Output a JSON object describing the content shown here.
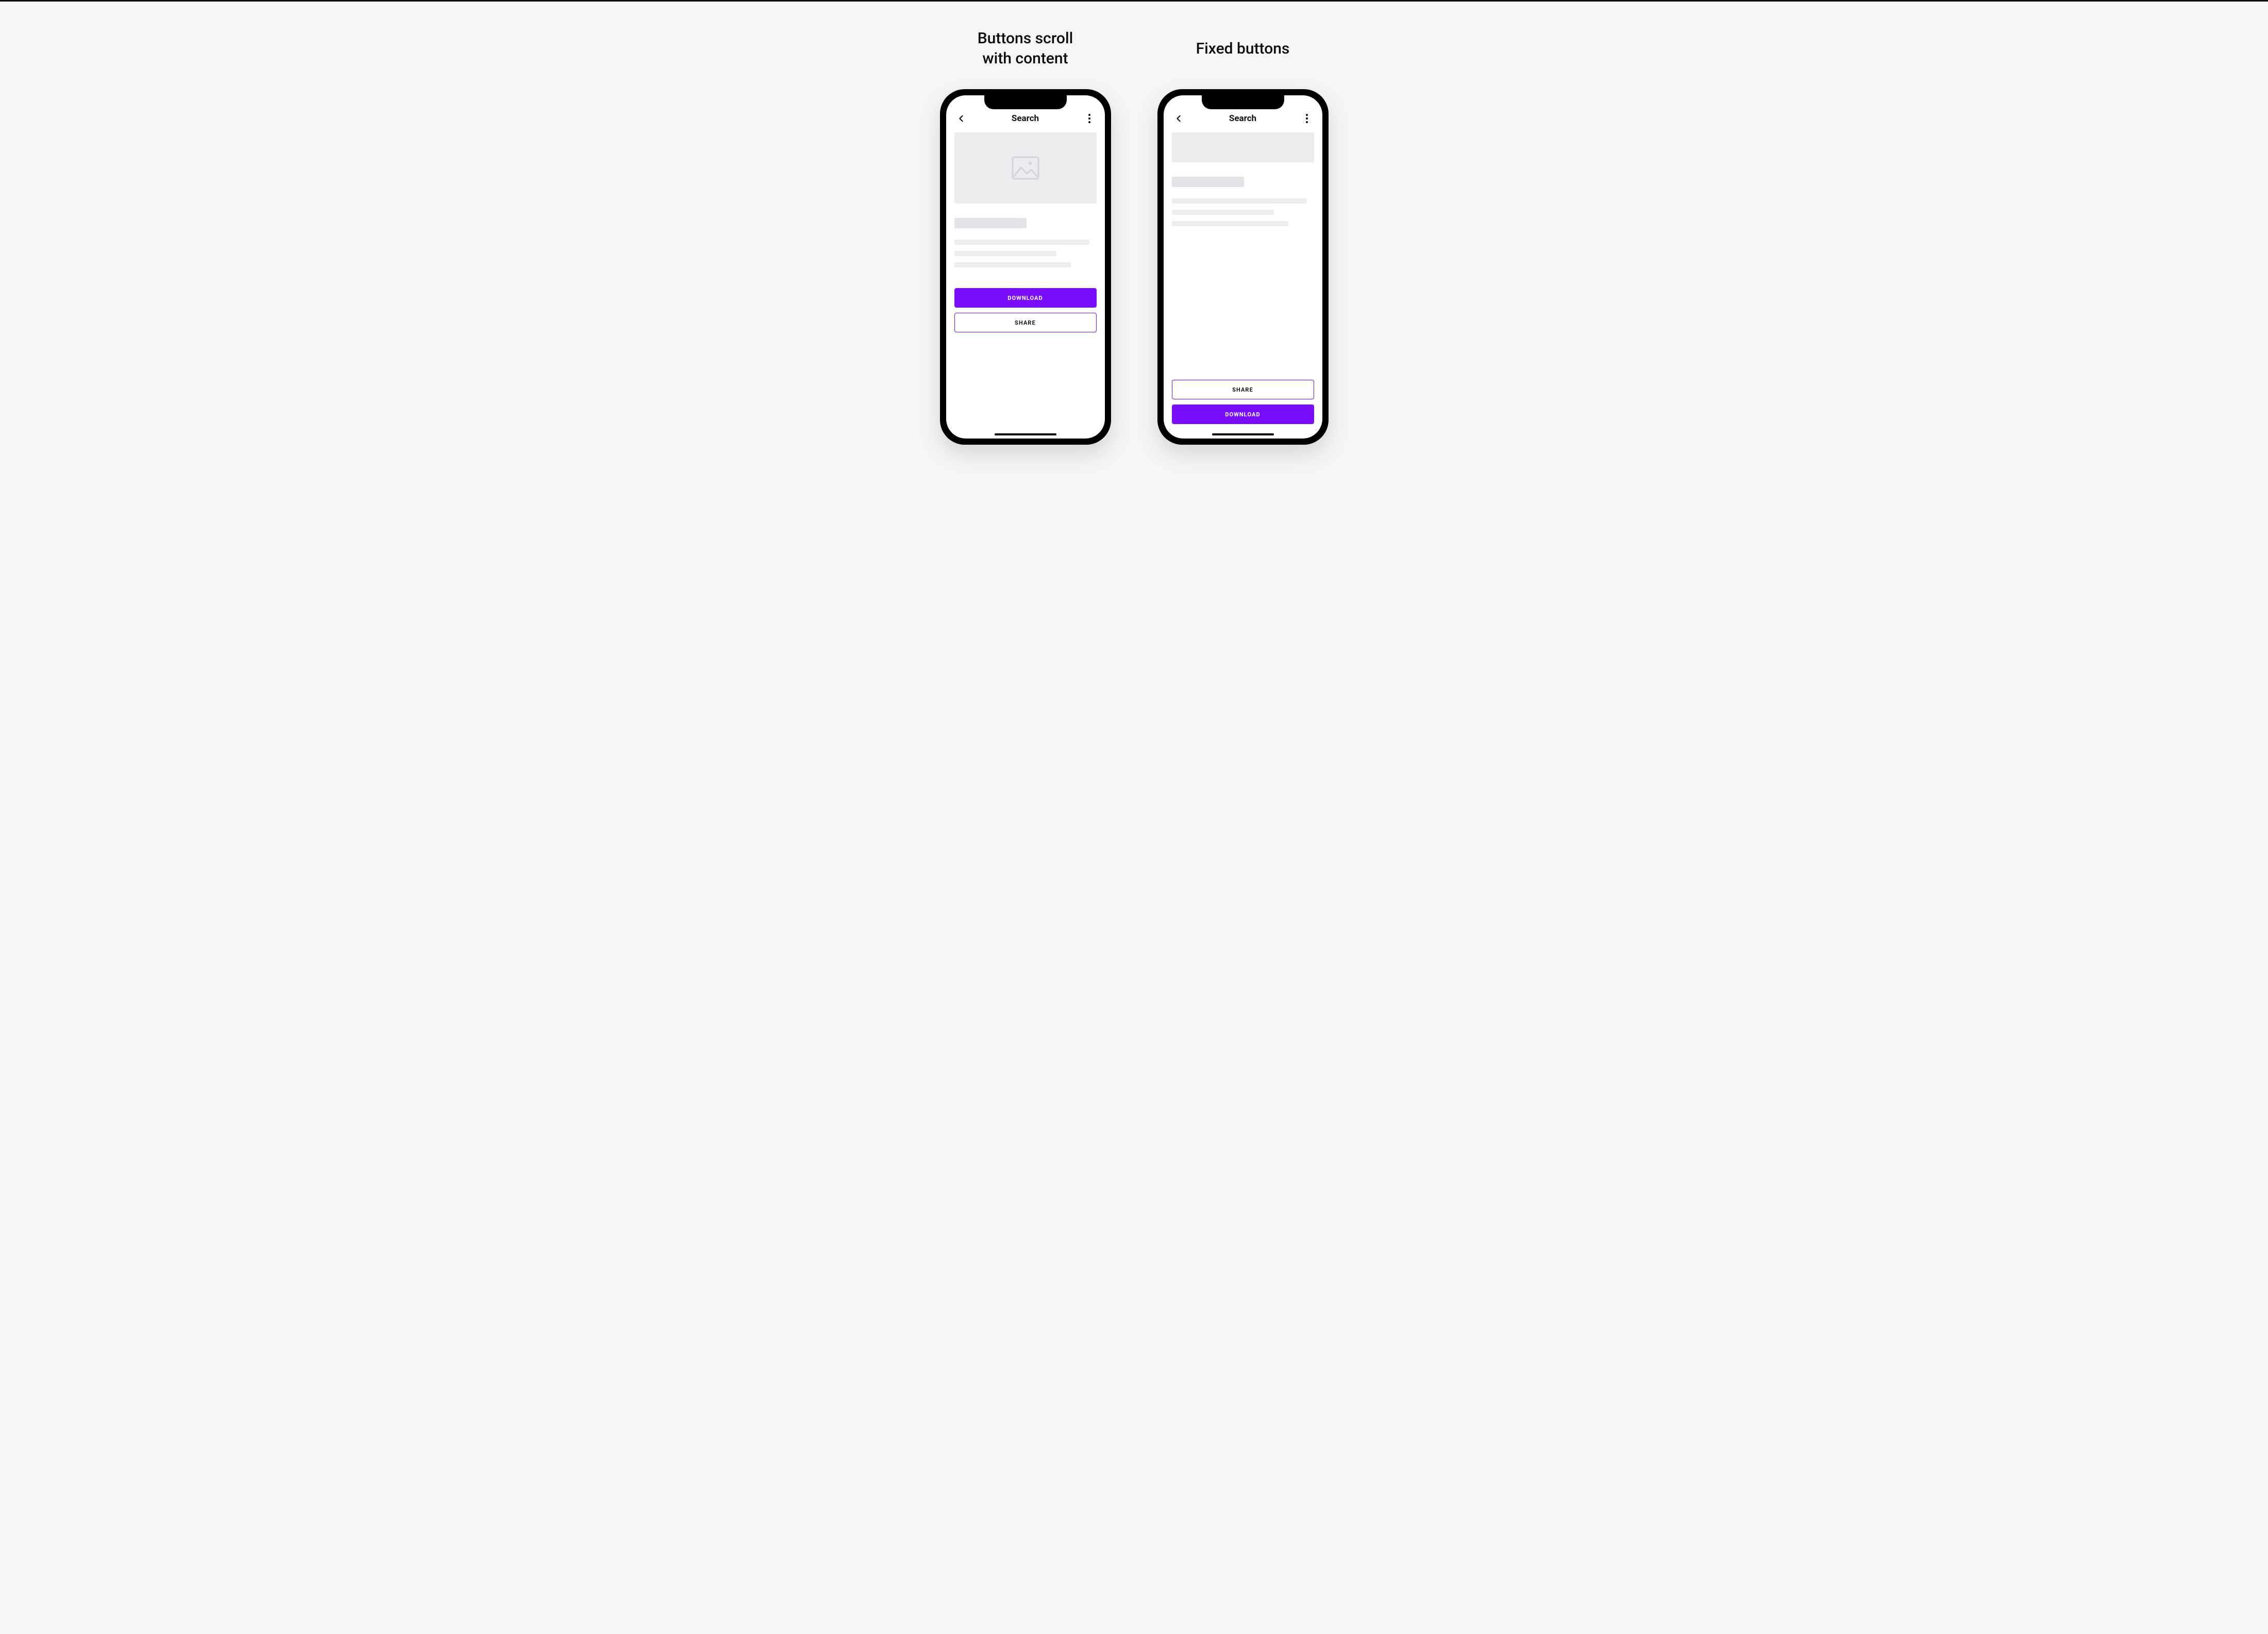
{
  "left": {
    "title": "Buttons scroll\nwith content",
    "screen": {
      "topbar_title": "Search",
      "download_label": "DOWNLOAD",
      "share_label": "SHARE"
    }
  },
  "right": {
    "title": "Fixed buttons",
    "screen": {
      "topbar_title": "Search",
      "download_label": "DOWNLOAD",
      "share_label": "SHARE"
    }
  },
  "colors": {
    "accent": "#7a0cff"
  }
}
